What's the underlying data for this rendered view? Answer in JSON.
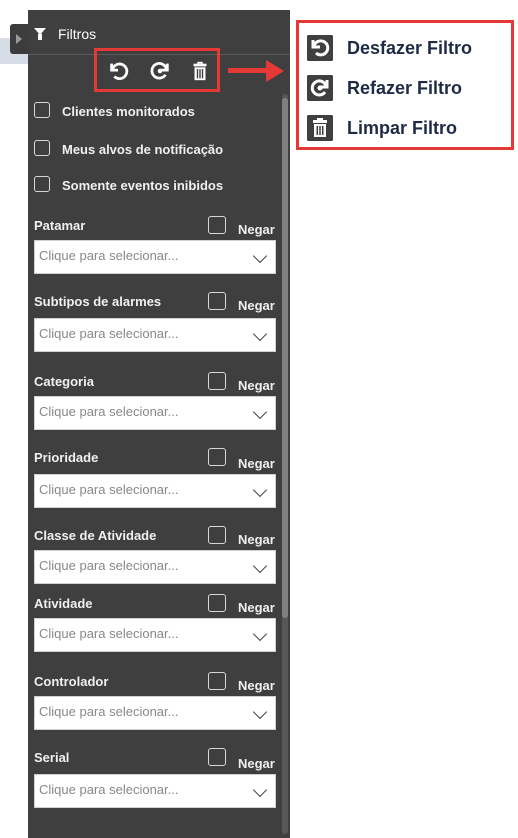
{
  "panel": {
    "title": "Filtros",
    "toolbar": {
      "undo_icon": "undo-icon",
      "redo_icon": "redo-icon",
      "clear_icon": "trash-icon"
    },
    "checkboxes": [
      {
        "label": "Clientes monitorados",
        "checked": false
      },
      {
        "label": "Meus alvos de notificação",
        "checked": false
      },
      {
        "label": "Somente eventos inibidos",
        "checked": false
      }
    ],
    "filters": [
      {
        "label": "Patamar",
        "negar": "Negar",
        "placeholder": "Clique para selecionar..."
      },
      {
        "label": "Subtipos de alarmes",
        "negar": "Negar",
        "placeholder": "Clique para selecionar..."
      },
      {
        "label": "Categoria",
        "negar": "Negar",
        "placeholder": "Clique para selecionar..."
      },
      {
        "label": "Prioridade",
        "negar": "Negar",
        "placeholder": "Clique para selecionar..."
      },
      {
        "label": "Classe de Atividade",
        "negar": "Negar",
        "placeholder": "Clique para selecionar..."
      },
      {
        "label": "Atividade",
        "negar": "Negar",
        "placeholder": "Clique para selecionar..."
      },
      {
        "label": "Controlador",
        "negar": "Negar",
        "placeholder": "Clique para selecionar..."
      },
      {
        "label": "Serial",
        "negar": "Negar",
        "placeholder": "Clique para selecionar..."
      }
    ]
  },
  "legend": {
    "items": [
      {
        "icon": "undo-icon",
        "label": "Desfazer Filtro"
      },
      {
        "icon": "redo-icon",
        "label": "Refazer Filtro"
      },
      {
        "icon": "trash-icon",
        "label": "Limpar Filtro"
      }
    ]
  },
  "colors": {
    "panel_bg": "#3f3f3f",
    "highlight": "#e53935",
    "legend_text": "#1f2a44"
  }
}
